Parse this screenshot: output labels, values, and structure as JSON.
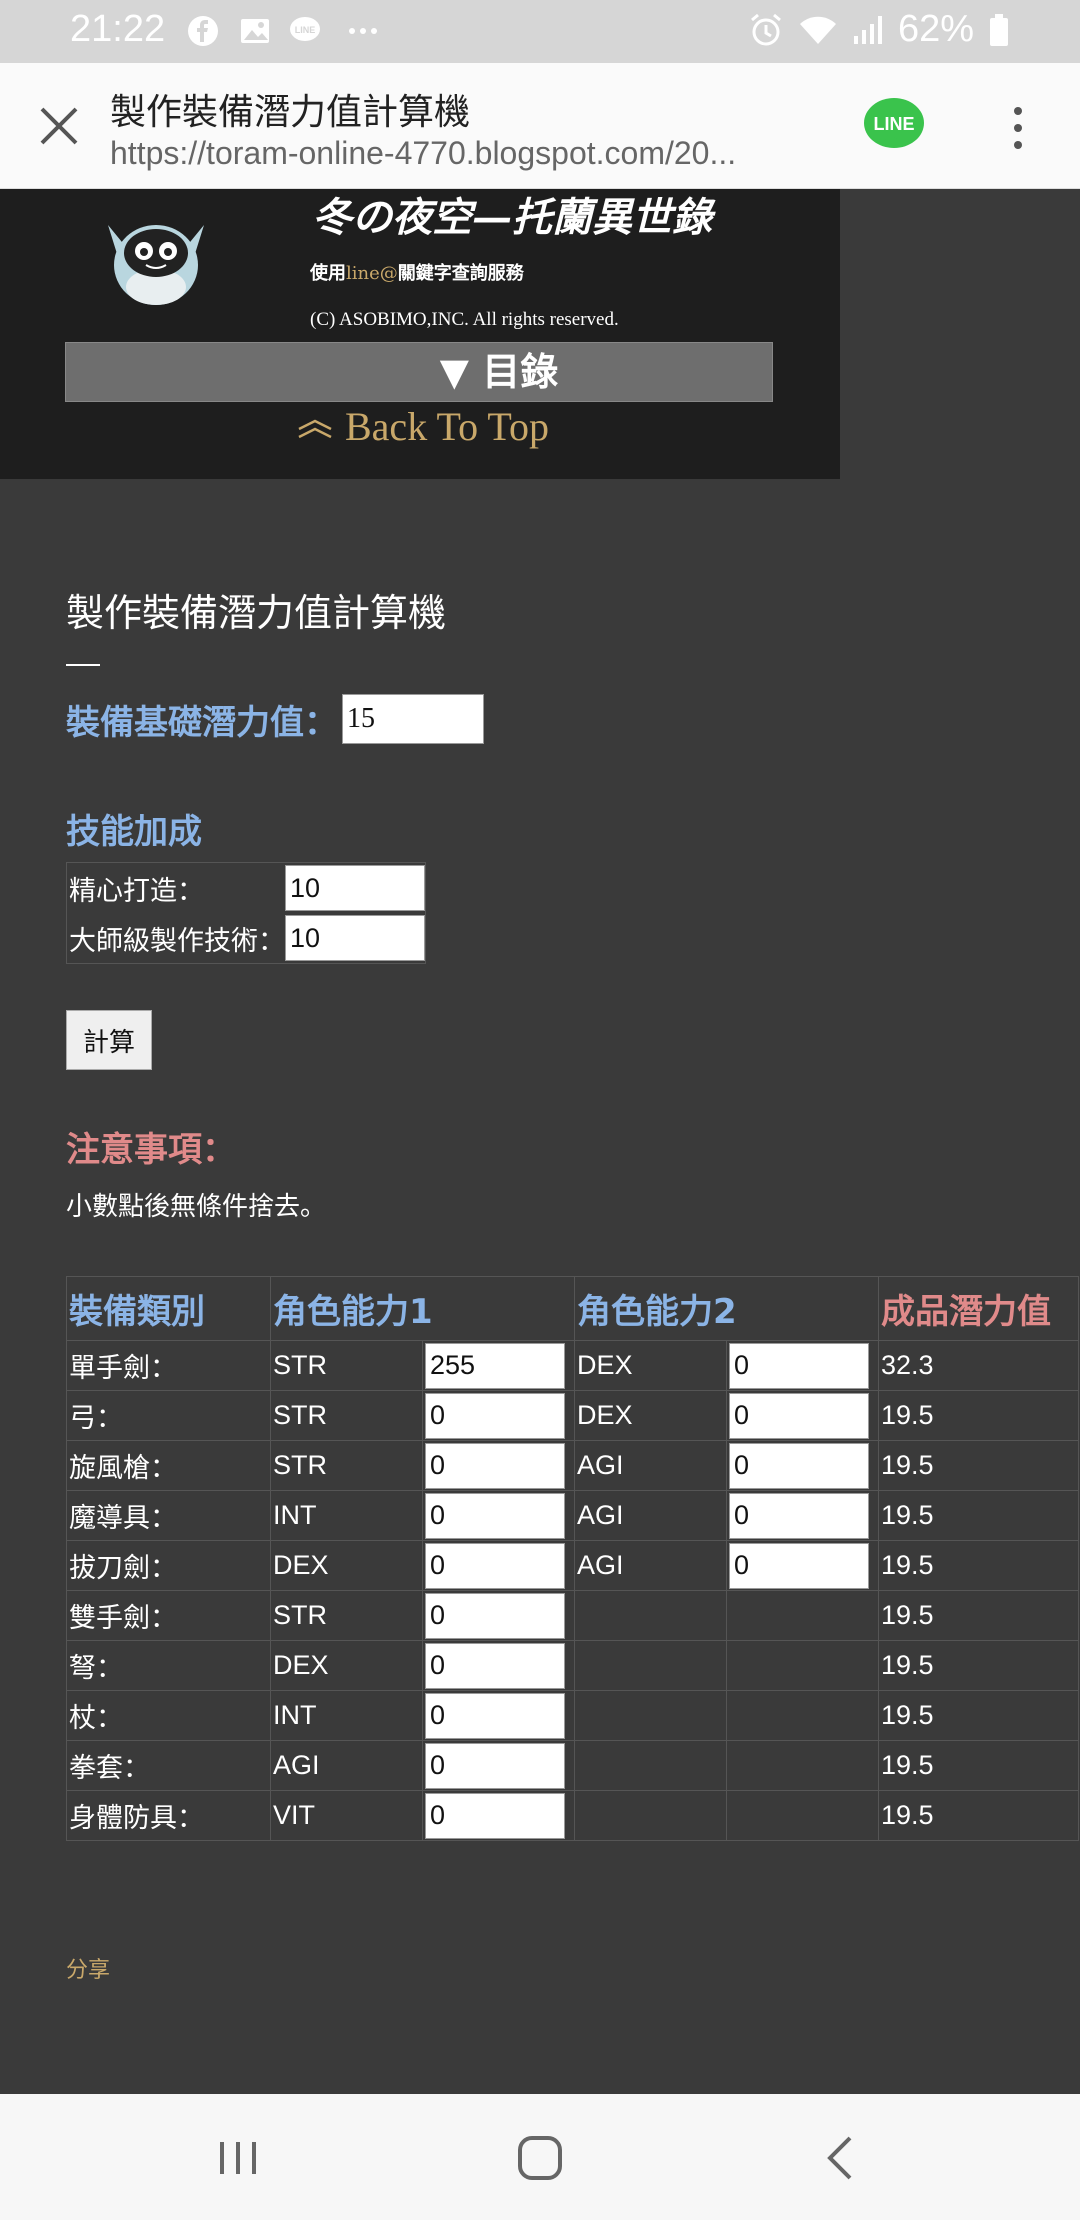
{
  "status": {
    "time": "21:22",
    "battery": "62%"
  },
  "browser": {
    "title": "製作裝備潛力值計算機",
    "url": "https://toram-online-4770.blogspot.com/20..."
  },
  "banner": {
    "site_title": "冬の夜空—托蘭異世錄",
    "line_prefix": "使用",
    "line_at": "line@",
    "line_suffix": "關鍵字查詢服務",
    "copyright": "(C) ASOBIMO,INC. All rights reserved.",
    "menu_label": "▼ 目錄",
    "back_to_top": "Back To Top"
  },
  "page": {
    "title": "製作裝備潛力值計算機",
    "base_label": "裝備基礎潛力值：",
    "base_value": "15",
    "skill_heading": "技能加成",
    "skills": [
      {
        "label": "精心打造：",
        "value": "10"
      },
      {
        "label": "大師級製作技術：",
        "value": "10"
      }
    ],
    "calc_label": "計算",
    "note_heading": "注意事項：",
    "note_text": "小數點後無條件捨去。"
  },
  "table": {
    "headers": [
      "裝備類別",
      "角色能力1",
      "角色能力2",
      "成品潛力值"
    ],
    "rows": [
      {
        "cat": "單手劍：",
        "s1": "STR",
        "v1": "255",
        "s2": "DEX",
        "v2": "0",
        "res": "32.3"
      },
      {
        "cat": "弓：",
        "s1": "STR",
        "v1": "0",
        "s2": "DEX",
        "v2": "0",
        "res": "19.5"
      },
      {
        "cat": "旋風槍：",
        "s1": "STR",
        "v1": "0",
        "s2": "AGI",
        "v2": "0",
        "res": "19.5"
      },
      {
        "cat": "魔導具：",
        "s1": "INT",
        "v1": "0",
        "s2": "AGI",
        "v2": "0",
        "res": "19.5"
      },
      {
        "cat": "拔刀劍：",
        "s1": "DEX",
        "v1": "0",
        "s2": "AGI",
        "v2": "0",
        "res": "19.5"
      },
      {
        "cat": "雙手劍：",
        "s1": "STR",
        "v1": "0",
        "s2": "",
        "v2": null,
        "res": "19.5"
      },
      {
        "cat": "弩：",
        "s1": "DEX",
        "v1": "0",
        "s2": "",
        "v2": null,
        "res": "19.5"
      },
      {
        "cat": "杖：",
        "s1": "INT",
        "v1": "0",
        "s2": "",
        "v2": null,
        "res": "19.5"
      },
      {
        "cat": "拳套：",
        "s1": "AGI",
        "v1": "0",
        "s2": "",
        "v2": null,
        "res": "19.5"
      },
      {
        "cat": "身體防具：",
        "s1": "VIT",
        "v1": "0",
        "s2": "",
        "v2": null,
        "res": "19.5"
      }
    ]
  },
  "share_label": "分享",
  "colors": {
    "accent_blue": "#8bb4e6",
    "accent_red": "#e08a8a",
    "gold": "#c9a86a",
    "line_green": "#3ac34c"
  },
  "icons": [
    "facebook-icon",
    "gallery-icon",
    "line-notification-icon",
    "more-notifications-icon",
    "alarm-icon",
    "wifi-icon",
    "signal-icon",
    "battery-icon",
    "close-icon",
    "line-app-icon",
    "overflow-menu-icon",
    "recents-icon",
    "home-icon",
    "back-icon"
  ]
}
